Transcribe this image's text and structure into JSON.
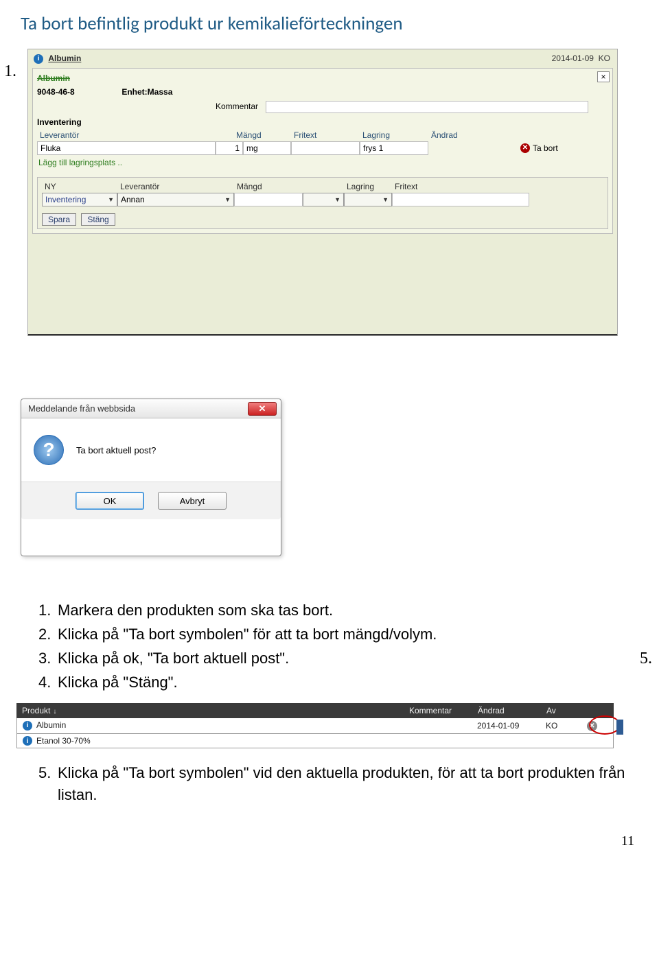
{
  "page_title": "Ta bort befintlig produkt ur kemikalieförteckningen",
  "annotations": {
    "a1": "1.",
    "a2": "2.",
    "a3": "3.",
    "a4": "4.",
    "a5": "5."
  },
  "shot1": {
    "header": {
      "name": "Albumin",
      "date": "2014-01-09",
      "by": "KO"
    },
    "title_strikethrough": "Albumin",
    "cas": "9048-46-8",
    "enhet_label": "Enhet:Massa",
    "kommentar_label": "Kommentar",
    "kommentar_value": "",
    "section_label": "Inventering",
    "cols": {
      "leverantor": "Leverantör",
      "mangd": "Mängd",
      "fritext": "Fritext",
      "lagring": "Lagring",
      "andrad": "Ändrad"
    },
    "row": {
      "leverantor": "Fluka",
      "mangd_n": "1",
      "mangd_u": "mg",
      "fritext": "",
      "lagring": "frys 1",
      "andrad": "",
      "delete": "Ta bort"
    },
    "add_location": "Lägg till lagringsplats ..",
    "cols2": {
      "ny": "NY",
      "leverantor": "Leverantör",
      "mangd": "Mängd",
      "lagring": "Lagring",
      "fritext": "Fritext"
    },
    "row2": {
      "ny": "Inventering",
      "leverantor": "Annan"
    },
    "buttons": {
      "spara": "Spara",
      "stang": "Stäng"
    }
  },
  "dialog": {
    "title": "Meddelande från webbsida",
    "message": "Ta bort aktuell post?",
    "ok": "OK",
    "cancel": "Avbryt"
  },
  "instructions_a": [
    "Markera den produkten som ska tas bort.",
    "Klicka på \"Ta bort symbolen\" för att ta bort mängd/volym.",
    "Klicka på ok, \"Ta bort aktuell post\".",
    "Klicka på \"Stäng\"."
  ],
  "productlist": {
    "headers": {
      "produkt": "Produkt",
      "kommentar": "Kommentar",
      "andrad": "Ändrad",
      "av": "Av"
    },
    "rows": [
      {
        "name": "Albumin",
        "kommentar": "",
        "andrad": "2014-01-09",
        "av": "KO"
      },
      {
        "name": "Etanol 30-70%",
        "kommentar": "",
        "andrad": "",
        "av": ""
      }
    ]
  },
  "instructions_b": [
    "Klicka på \"Ta bort symbolen\" vid den aktuella produkten, för att ta bort produkten från listan."
  ],
  "page_number": "11"
}
